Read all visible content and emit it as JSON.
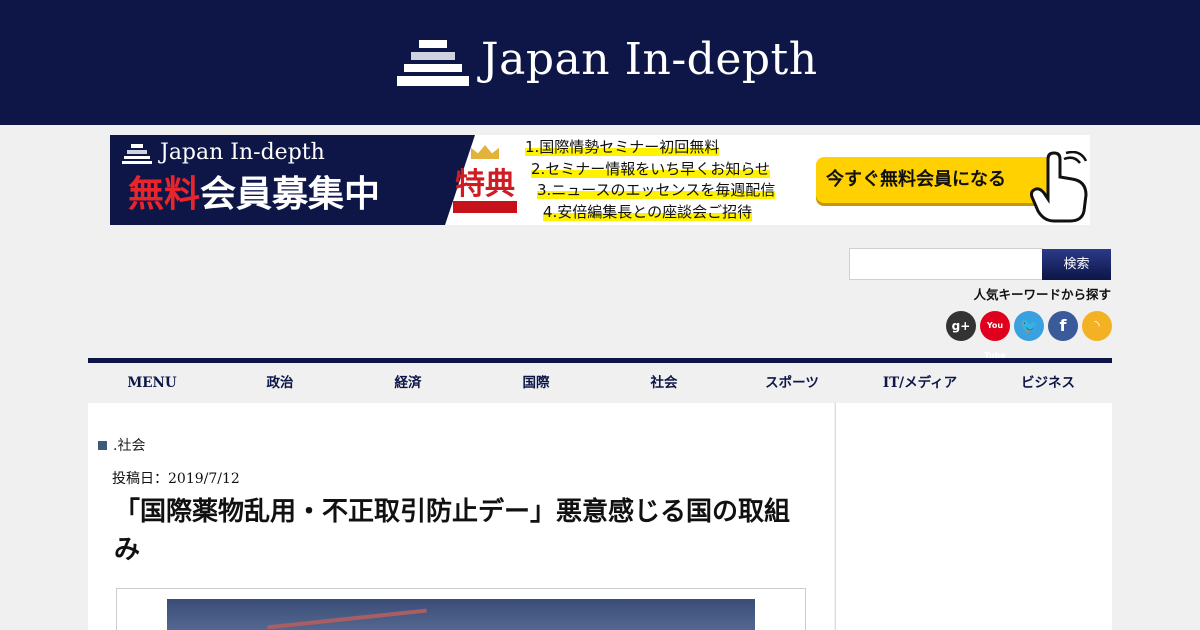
{
  "header": {
    "logo_text": "Japan In-depth"
  },
  "banner": {
    "brand": "Japan In-depth",
    "title_red": "無料",
    "title_white": "会員",
    "title_red2": "募集中",
    "badge": "特典",
    "benefits": [
      "1.国際情勢セミナー初回無料",
      "2.セミナー情報をいち早くお知らせ",
      "3.ニュースのエッセンスを毎週配信",
      "4.安倍編集長との座談会ご招待"
    ],
    "cta_label": "今すぐ無料会員になる",
    "colors": {
      "navy": "#0d1646",
      "red": "#e8242c",
      "yellow": "#ffd100"
    }
  },
  "search": {
    "value": "",
    "placeholder": "",
    "button_label": "検索",
    "popular_label": "人気キーワードから探す"
  },
  "social": {
    "items": [
      {
        "icon": "google-plus-icon",
        "glyph": "g+"
      },
      {
        "icon": "youtube-icon",
        "glyph": "You Tube"
      },
      {
        "icon": "twitter-icon",
        "glyph": "🐦"
      },
      {
        "icon": "facebook-icon",
        "glyph": "f"
      },
      {
        "icon": "rss-icon",
        "glyph": "◝"
      }
    ]
  },
  "nav": {
    "items": [
      "MENU",
      "政治",
      "経済",
      "国際",
      "社会",
      "スポーツ",
      "IT/メディア",
      "ビジネス"
    ]
  },
  "article": {
    "category": ".社会",
    "posted_date": "投稿日：2019/7/12",
    "title": "「国際薬物乱用・不正取引防止デー」悪意感じる国の取組み"
  }
}
